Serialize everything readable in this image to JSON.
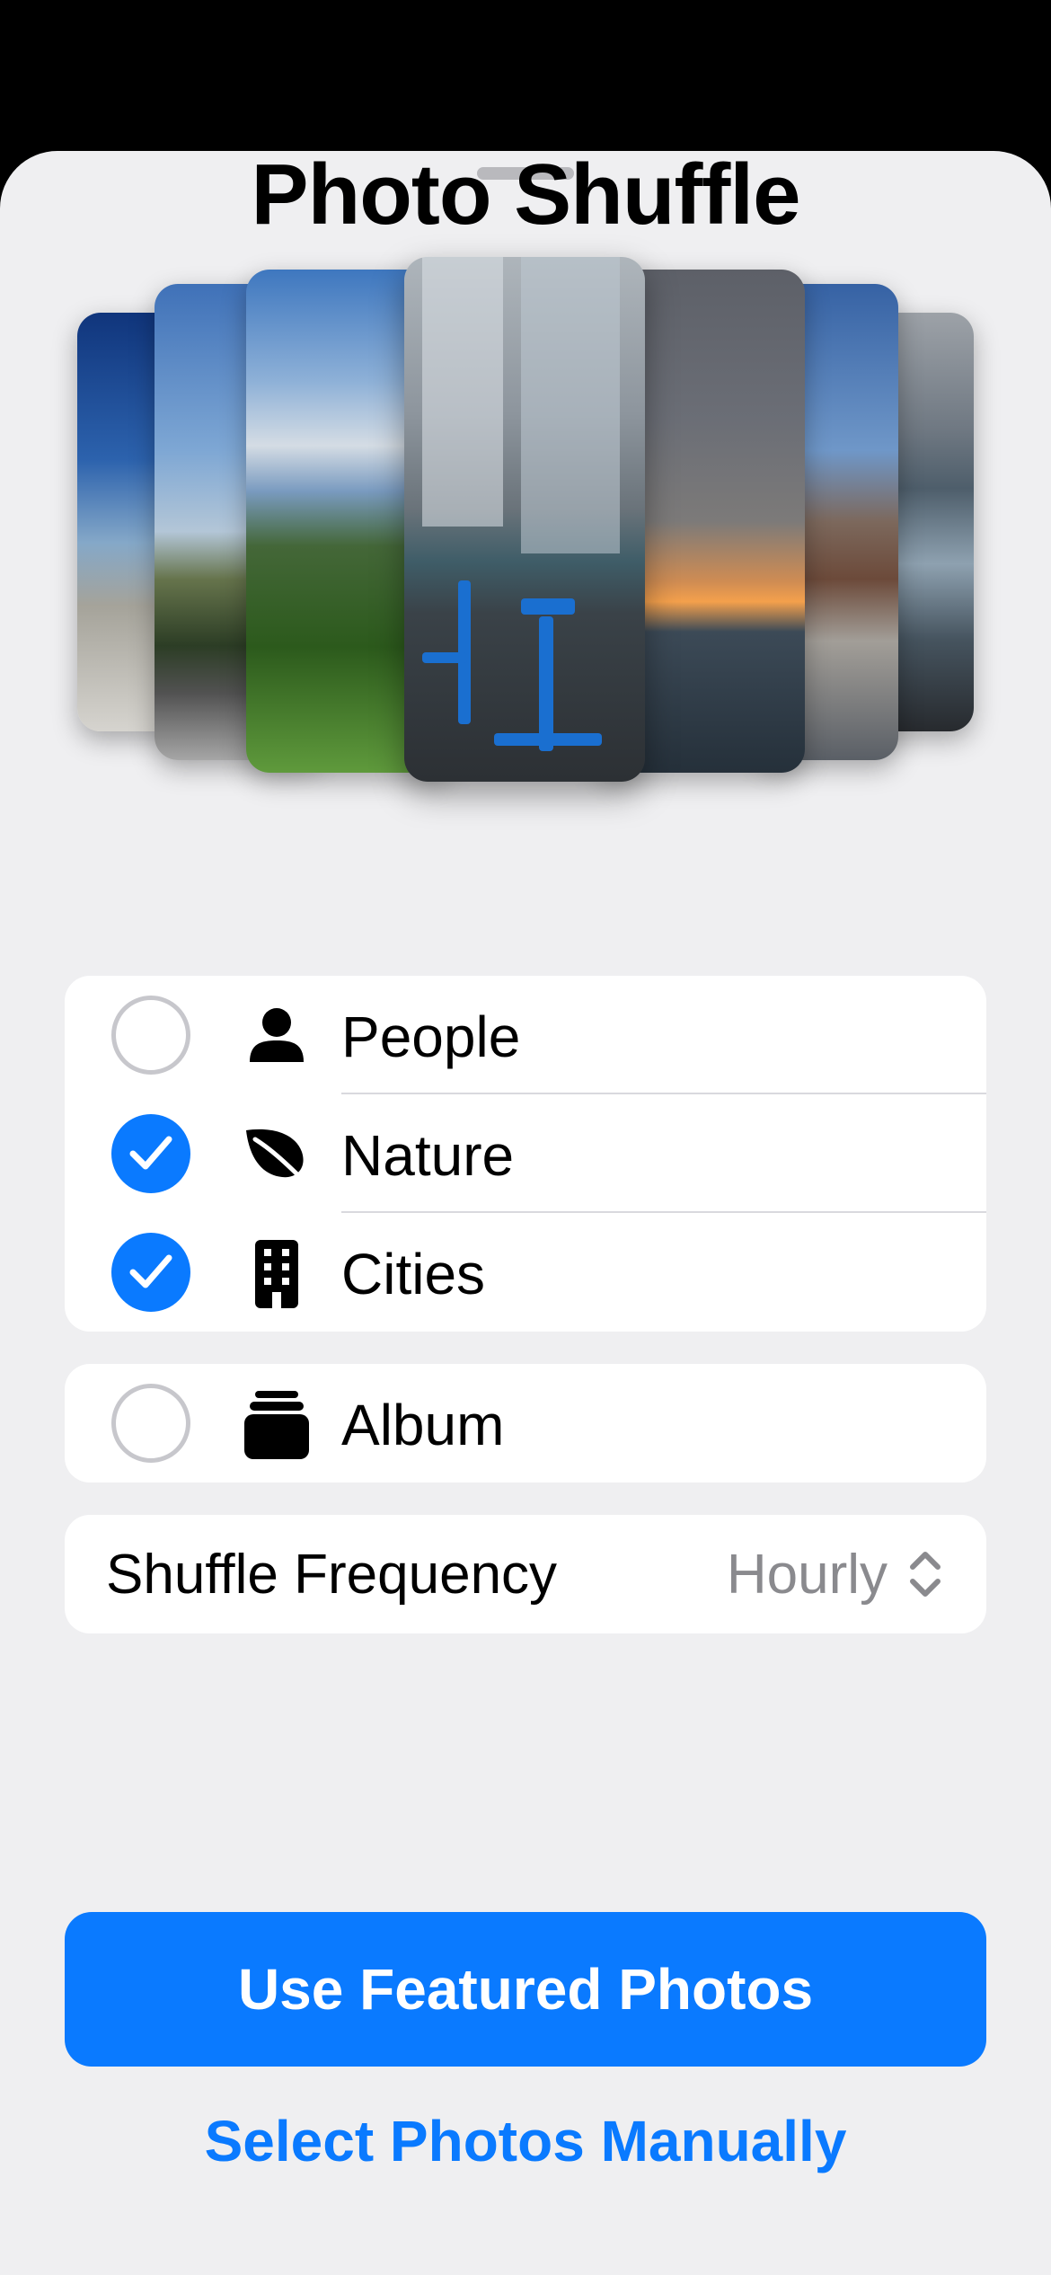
{
  "title": "Photo Shuffle",
  "categories": [
    {
      "label": "People",
      "icon": "person-icon",
      "checked": false
    },
    {
      "label": "Nature",
      "icon": "leaf-icon",
      "checked": true
    },
    {
      "label": "Cities",
      "icon": "building-icon",
      "checked": true
    }
  ],
  "album": {
    "label": "Album",
    "icon": "album-stack-icon",
    "checked": false
  },
  "frequency": {
    "label": "Shuffle Frequency",
    "value": "Hourly"
  },
  "primary_button": "Use Featured Photos",
  "secondary_button": "Select Photos Manually",
  "colors": {
    "accent": "#0a7aff",
    "background": "#efeff1"
  }
}
